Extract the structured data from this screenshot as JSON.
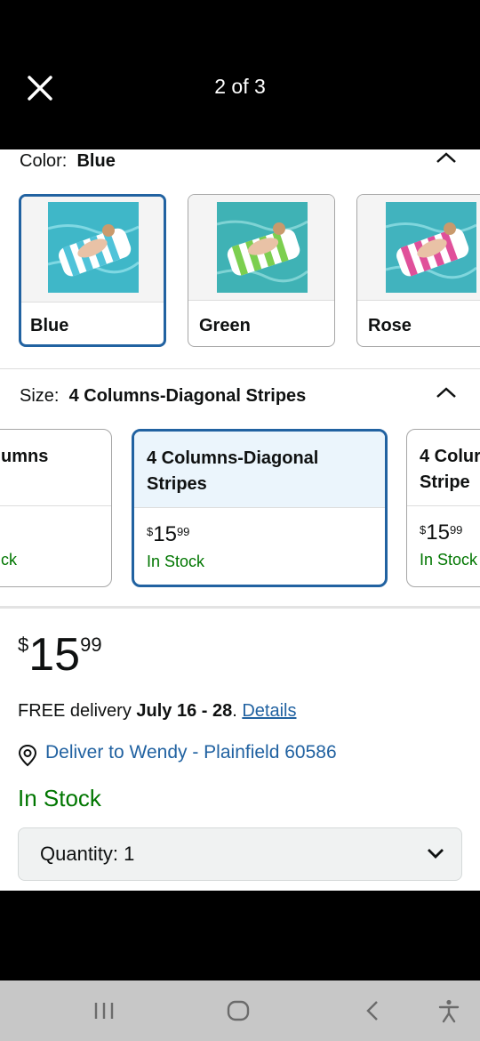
{
  "viewer": {
    "counter": "2 of 3"
  },
  "color": {
    "label": "Color:",
    "selected": "Blue",
    "options": [
      {
        "name": "Blue",
        "stripe": "#4fc3d9"
      },
      {
        "name": "Green",
        "stripe": "#7ccf4f"
      },
      {
        "name": "Rose",
        "stripe": "#e0509a"
      }
    ]
  },
  "size": {
    "label": "Size:",
    "selected": "4 Columns-Diagonal Stripes",
    "options": [
      {
        "name": "umns",
        "stock": "ck"
      },
      {
        "name_line1": "4 Columns-Diagonal",
        "name_line2": "Stripes",
        "price_whole": "15",
        "price_cents": "99",
        "currency": "$",
        "stock": "In Stock"
      },
      {
        "name_line1": "4 Colur",
        "name_line2": "Stripe",
        "price_whole": "15",
        "price_cents": "99",
        "currency": "$",
        "stock": "In Stock"
      }
    ]
  },
  "price": {
    "currency": "$",
    "whole": "15",
    "cents": "99"
  },
  "delivery": {
    "prefix": "FREE delivery ",
    "dates": "July 16 - 28",
    "suffix": ". ",
    "details_link": "Details"
  },
  "deliver_to": "Deliver to Wendy - Plainfield 60586",
  "stock_status": "In Stock",
  "quantity": {
    "label": "Quantity:",
    "value": "1"
  },
  "colors": {
    "accent_blue": "#2162a1",
    "in_stock_green": "#007600"
  }
}
